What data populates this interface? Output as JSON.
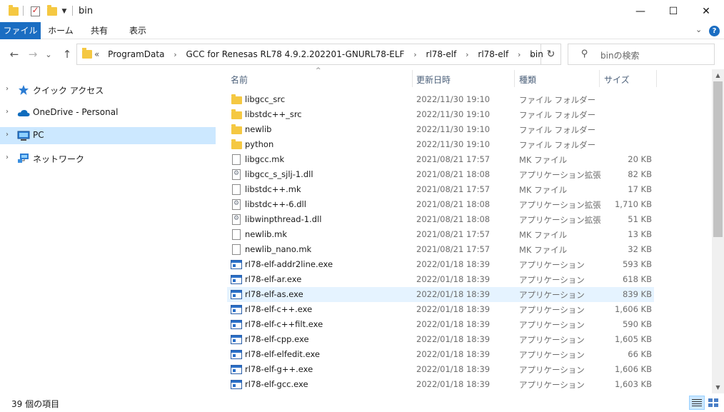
{
  "window": {
    "title": "bin",
    "minimize_glyph": "—",
    "maximize_glyph": "☐",
    "close_glyph": "✕"
  },
  "ribbon": {
    "tabs": [
      "ファイル",
      "ホーム",
      "共有",
      "表示"
    ],
    "collapse_glyph": "⌄",
    "help_glyph": "?"
  },
  "nav": {
    "back_glyph": "←",
    "forward_glyph": "→",
    "recent_glyph": "⌄",
    "up_glyph": "↑"
  },
  "address": {
    "overflow": "«",
    "crumbs": [
      "ProgramData",
      "GCC for Renesas RL78 4.9.2.202201-GNURL78-ELF",
      "rl78-elf",
      "rl78-elf",
      "bin"
    ],
    "separator": "›",
    "dropdown_glyph": "⌄",
    "refresh_glyph": "↻"
  },
  "search": {
    "placeholder": "binの検索"
  },
  "navpane": {
    "items": [
      {
        "label": "クイック アクセス",
        "icon": "star-icon",
        "selected": false
      },
      {
        "label": "OneDrive - Personal",
        "icon": "cloud-icon",
        "selected": false
      },
      {
        "label": "PC",
        "icon": "computer-icon",
        "selected": true
      },
      {
        "label": "ネットワーク",
        "icon": "network-icon",
        "selected": false
      }
    ],
    "chevron_glyph": "›"
  },
  "columns": {
    "name": "名前",
    "date": "更新日時",
    "type": "種類",
    "size": "サイズ",
    "sort_glyph": "^"
  },
  "files": [
    {
      "name": "libgcc_src",
      "date": "2022/11/30 19:10",
      "type": "ファイル フォルダー",
      "size": "",
      "kind": "folder"
    },
    {
      "name": "libstdc++_src",
      "date": "2022/11/30 19:10",
      "type": "ファイル フォルダー",
      "size": "",
      "kind": "folder"
    },
    {
      "name": "newlib",
      "date": "2022/11/30 19:10",
      "type": "ファイル フォルダー",
      "size": "",
      "kind": "folder"
    },
    {
      "name": "python",
      "date": "2022/11/30 19:10",
      "type": "ファイル フォルダー",
      "size": "",
      "kind": "folder"
    },
    {
      "name": "libgcc.mk",
      "date": "2021/08/21 17:57",
      "type": "MK ファイル",
      "size": "20 KB",
      "kind": "doc"
    },
    {
      "name": "libgcc_s_sjlj-1.dll",
      "date": "2021/08/21 18:08",
      "type": "アプリケーション拡張",
      "size": "82 KB",
      "kind": "dll"
    },
    {
      "name": "libstdc++.mk",
      "date": "2021/08/21 17:57",
      "type": "MK ファイル",
      "size": "17 KB",
      "kind": "doc"
    },
    {
      "name": "libstdc++-6.dll",
      "date": "2021/08/21 18:08",
      "type": "アプリケーション拡張",
      "size": "1,710 KB",
      "kind": "dll"
    },
    {
      "name": "libwinpthread-1.dll",
      "date": "2021/08/21 18:08",
      "type": "アプリケーション拡張",
      "size": "51 KB",
      "kind": "dll"
    },
    {
      "name": "newlib.mk",
      "date": "2021/08/21 17:57",
      "type": "MK ファイル",
      "size": "13 KB",
      "kind": "doc"
    },
    {
      "name": "newlib_nano.mk",
      "date": "2021/08/21 17:57",
      "type": "MK ファイル",
      "size": "32 KB",
      "kind": "doc"
    },
    {
      "name": "rl78-elf-addr2line.exe",
      "date": "2022/01/18 18:39",
      "type": "アプリケーション",
      "size": "593 KB",
      "kind": "exe"
    },
    {
      "name": "rl78-elf-ar.exe",
      "date": "2022/01/18 18:39",
      "type": "アプリケーション",
      "size": "618 KB",
      "kind": "exe"
    },
    {
      "name": "rl78-elf-as.exe",
      "date": "2022/01/18 18:39",
      "type": "アプリケーション",
      "size": "839 KB",
      "kind": "exe",
      "hover": true
    },
    {
      "name": "rl78-elf-c++.exe",
      "date": "2022/01/18 18:39",
      "type": "アプリケーション",
      "size": "1,606 KB",
      "kind": "exe"
    },
    {
      "name": "rl78-elf-c++filt.exe",
      "date": "2022/01/18 18:39",
      "type": "アプリケーション",
      "size": "590 KB",
      "kind": "exe"
    },
    {
      "name": "rl78-elf-cpp.exe",
      "date": "2022/01/18 18:39",
      "type": "アプリケーション",
      "size": "1,605 KB",
      "kind": "exe"
    },
    {
      "name": "rl78-elf-elfedit.exe",
      "date": "2022/01/18 18:39",
      "type": "アプリケーション",
      "size": "66 KB",
      "kind": "exe"
    },
    {
      "name": "rl78-elf-g++.exe",
      "date": "2022/01/18 18:39",
      "type": "アプリケーション",
      "size": "1,606 KB",
      "kind": "exe"
    },
    {
      "name": "rl78-elf-gcc.exe",
      "date": "2022/01/18 18:39",
      "type": "アプリケーション",
      "size": "1,603 KB",
      "kind": "exe"
    }
  ],
  "status": {
    "count": "39 個の項目"
  },
  "colors": {
    "accent": "#1a6dc2",
    "selected": "#cce8ff",
    "hover": "#e5f3ff",
    "folder": "#f5c842"
  }
}
